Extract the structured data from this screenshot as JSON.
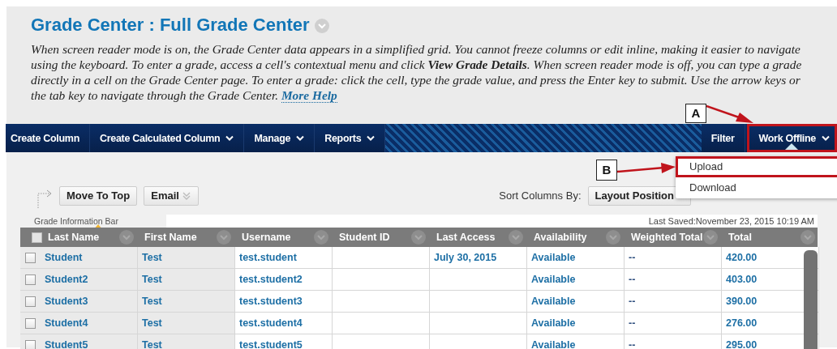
{
  "page_title": "Grade Center : Full Grade Center",
  "description": "When screen reader mode is on, the Grade Center data appears in a simplified grid. You cannot freeze columns or edit inline, making it easier to navigate using the keyboard. To enter a grade, access a cell's contextual menu and click **View Grade Details**. When screen reader mode is off, you can type a grade directly in a cell on the Grade Center page. To enter a grade: click the cell, type the grade value, and press the Enter key to submit. Use the arrow keys or the tab key to navigate through the Grade Center.",
  "more_help": "More Help",
  "nav_left": [
    {
      "label": "Create Column",
      "has_menu": false
    },
    {
      "label": "Create Calculated Column",
      "has_menu": true
    },
    {
      "label": "Manage",
      "has_menu": true
    },
    {
      "label": "Reports",
      "has_menu": true
    }
  ],
  "nav_right": [
    {
      "label": "Filter",
      "has_menu": false,
      "expanded": false,
      "callout": false
    },
    {
      "label": "Work Offline",
      "has_menu": true,
      "expanded": true,
      "callout": true
    }
  ],
  "dropdown": [
    {
      "label": "Upload",
      "callout": true
    },
    {
      "label": "Download",
      "callout": false
    }
  ],
  "actions": [
    "Move To Top",
    "Email"
  ],
  "sort_label": "Sort Columns By:",
  "sort_value": "Layout Position",
  "info_bar": "Grade Information Bar",
  "last_saved": "Last Saved:November 23, 2015 10:19 AM",
  "select_all_checked": false,
  "columns": [
    "Last Name",
    "First Name",
    "Username",
    "Student ID",
    "Last Access",
    "Availability",
    "Weighted Total",
    "Total"
  ],
  "rows": [
    {
      "checked": false,
      "cells": [
        "Student",
        "Test",
        "test.student",
        "",
        "July 30, 2015",
        "Available",
        "--",
        "420.00"
      ]
    },
    {
      "checked": false,
      "cells": [
        "Student2",
        "Test",
        "test.student2",
        "",
        "",
        "Available",
        "--",
        "403.00"
      ]
    },
    {
      "checked": false,
      "cells": [
        "Student3",
        "Test",
        "test.student3",
        "",
        "",
        "Available",
        "--",
        "390.00"
      ]
    },
    {
      "checked": false,
      "cells": [
        "Student4",
        "Test",
        "test.student4",
        "",
        "",
        "Available",
        "--",
        "276.00"
      ]
    },
    {
      "checked": false,
      "cells": [
        "Student5",
        "Test",
        "test.student5",
        "",
        "",
        "Available",
        "--",
        "295.00"
      ]
    }
  ],
  "annotations": [
    {
      "label": "A"
    },
    {
      "label": "B"
    }
  ]
}
